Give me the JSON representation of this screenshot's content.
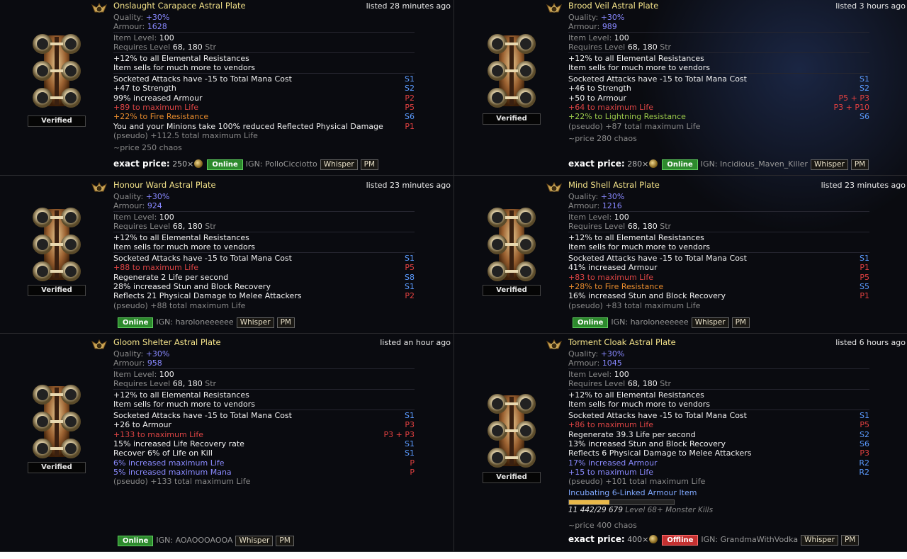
{
  "items": [
    {
      "title": "Onslaught Carapace Astral Plate",
      "listed": "listed 28 minutes ago",
      "verified": "Verified",
      "quality_label": "Quality: ",
      "quality": "+30%",
      "armour_label": "Armour: ",
      "armour": "1628",
      "ilvl_label": "Item Level: ",
      "ilvl": "100",
      "req_label": "Requires Level ",
      "req_lvl": "68",
      "req_sep": ", ",
      "req_str": "180",
      "req_stat": " Str",
      "implicits": [
        "+12% to all Elemental Resistances",
        "Item sells for much more to vendors"
      ],
      "mods": [
        {
          "text": "Socketed Attacks have -15 to Total Mana Cost",
          "tag": "S1",
          "c": "white",
          "tc": "sblue"
        },
        {
          "text": "+47 to Strength",
          "tag": "S2",
          "c": "white",
          "tc": "sblue"
        },
        {
          "text": "99% increased Armour",
          "tag": "P2",
          "c": "white",
          "tc": "sred"
        },
        {
          "text": "+89 to maximum Life",
          "tag": "P5",
          "c": "red",
          "tc": "sred"
        },
        {
          "text": "+22% to Fire Resistance",
          "tag": "S6",
          "c": "orange",
          "tc": "sblue"
        },
        {
          "text": "You and your Minions take 100% reduced Reflected Physical Damage",
          "tag": "P1",
          "c": "white",
          "tc": "sred"
        },
        {
          "text": "(pseudo) +112.5 total maximum Life",
          "tag": "",
          "c": "grey",
          "tc": "grey"
        }
      ],
      "note": "~price 250 chaos",
      "exact_label": "exact price:",
      "exact_value": "250×",
      "status": "Online",
      "ign": "IGN: PolloCicciotto",
      "whisper": "Whisper",
      "pm": "PM"
    },
    {
      "title": "Brood Veil Astral Plate",
      "listed": "listed 3 hours ago",
      "verified": "Verified",
      "quality_label": "Quality: ",
      "quality": "+30%",
      "armour_label": "Armour: ",
      "armour": "989",
      "ilvl_label": "Item Level: ",
      "ilvl": "100",
      "req_label": "Requires Level ",
      "req_lvl": "68",
      "req_sep": ", ",
      "req_str": "180",
      "req_stat": " Str",
      "implicits": [
        "+12% to all Elemental Resistances",
        "Item sells for much more to vendors"
      ],
      "mods": [
        {
          "text": "Socketed Attacks have -15 to Total Mana Cost",
          "tag": "S1",
          "c": "white",
          "tc": "sblue"
        },
        {
          "text": "+46 to Strength",
          "tag": "S2",
          "c": "white",
          "tc": "sblue"
        },
        {
          "text": "+50 to Armour",
          "tag": "P5 + P3",
          "c": "white",
          "tc": "sred"
        },
        {
          "text": "+64 to maximum Life",
          "tag": "P3 + P10",
          "c": "red",
          "tc": "sred"
        },
        {
          "text": "+22% to Lightning Resistance",
          "tag": "S6",
          "c": "green",
          "tc": "sblue"
        },
        {
          "text": "(pseudo) +87 total maximum Life",
          "tag": "",
          "c": "grey",
          "tc": "grey"
        }
      ],
      "note": "~price 280 chaos",
      "exact_label": "exact price:",
      "exact_value": "280×",
      "status": "Online",
      "ign": "IGN: Incidious_Maven_Killer",
      "whisper": "Whisper",
      "pm": "PM"
    },
    {
      "title": "Honour Ward Astral Plate",
      "listed": "listed 23 minutes ago",
      "verified": "Verified",
      "quality_label": "Quality: ",
      "quality": "+30%",
      "armour_label": "Armour: ",
      "armour": "924",
      "ilvl_label": "Item Level: ",
      "ilvl": "100",
      "req_label": "Requires Level ",
      "req_lvl": "68",
      "req_sep": ", ",
      "req_str": "180",
      "req_stat": " Str",
      "implicits": [
        "+12% to all Elemental Resistances",
        "Item sells for much more to vendors"
      ],
      "mods": [
        {
          "text": "Socketed Attacks have -15 to Total Mana Cost",
          "tag": "S1",
          "c": "white",
          "tc": "sblue"
        },
        {
          "text": "+88 to maximum Life",
          "tag": "P5",
          "c": "red",
          "tc": "sred"
        },
        {
          "text": "Regenerate 2 Life per second",
          "tag": "S8",
          "c": "white",
          "tc": "sblue"
        },
        {
          "text": "28% increased Stun and Block Recovery",
          "tag": "S1",
          "c": "white",
          "tc": "sblue"
        },
        {
          "text": "Reflects 21 Physical Damage to Melee Attackers",
          "tag": "P2",
          "c": "white",
          "tc": "sred"
        },
        {
          "text": "(pseudo) +88 total maximum Life",
          "tag": "",
          "c": "grey",
          "tc": "grey"
        }
      ],
      "note": "",
      "exact_label": "",
      "exact_value": "",
      "status": "Online",
      "ign": "IGN: haroloneeeeee",
      "whisper": "Whisper",
      "pm": "PM"
    },
    {
      "title": "Mind Shell Astral Plate",
      "listed": "listed 23 minutes ago",
      "verified": "Verified",
      "quality_label": "Quality: ",
      "quality": "+30%",
      "armour_label": "Armour: ",
      "armour": "1216",
      "ilvl_label": "Item Level: ",
      "ilvl": "100",
      "req_label": "Requires Level ",
      "req_lvl": "68",
      "req_sep": ", ",
      "req_str": "180",
      "req_stat": " Str",
      "implicits": [
        "+12% to all Elemental Resistances",
        "Item sells for much more to vendors"
      ],
      "mods": [
        {
          "text": "Socketed Attacks have -15 to Total Mana Cost",
          "tag": "S1",
          "c": "white",
          "tc": "sblue"
        },
        {
          "text": "41% increased Armour",
          "tag": "P1",
          "c": "white",
          "tc": "sred"
        },
        {
          "text": "+83 to maximum Life",
          "tag": "P5",
          "c": "red",
          "tc": "sred"
        },
        {
          "text": "+28% to Fire Resistance",
          "tag": "S5",
          "c": "orange",
          "tc": "sblue"
        },
        {
          "text": "16% increased Stun and Block Recovery",
          "tag": "P1",
          "c": "white",
          "tc": "sred"
        },
        {
          "text": "(pseudo) +83 total maximum Life",
          "tag": "",
          "c": "grey",
          "tc": "grey"
        }
      ],
      "note": "",
      "exact_label": "",
      "exact_value": "",
      "status": "Online",
      "ign": "IGN: haroloneeeeee",
      "whisper": "Whisper",
      "pm": "PM"
    },
    {
      "title": "Gloom Shelter Astral Plate",
      "listed": "listed an hour ago",
      "verified": "Verified",
      "quality_label": "Quality: ",
      "quality": "+30%",
      "armour_label": "Armour: ",
      "armour": "958",
      "ilvl_label": "Item Level: ",
      "ilvl": "100",
      "req_label": "Requires Level ",
      "req_lvl": "68",
      "req_sep": ", ",
      "req_str": "180",
      "req_stat": " Str",
      "implicits": [
        "+12% to all Elemental Resistances",
        "Item sells for much more to vendors"
      ],
      "mods": [
        {
          "text": "Socketed Attacks have -15 to Total Mana Cost",
          "tag": "S1",
          "c": "white",
          "tc": "sblue"
        },
        {
          "text": "+26 to Armour",
          "tag": "P3",
          "c": "white",
          "tc": "sred"
        },
        {
          "text": "+133 to maximum Life",
          "tag": "P3 + P3",
          "c": "red",
          "tc": "sred"
        },
        {
          "text": "15% increased Life Recovery rate",
          "tag": "S1",
          "c": "white",
          "tc": "sblue"
        },
        {
          "text": "Recover 6% of Life on Kill",
          "tag": "S1",
          "c": "white",
          "tc": "sblue"
        },
        {
          "text": "6% increased maximum Life",
          "tag": "P",
          "c": "mblue",
          "tc": "sred"
        },
        {
          "text": "5% increased maximum Mana",
          "tag": "P",
          "c": "mblue",
          "tc": "sred"
        },
        {
          "text": "(pseudo) +133 total maximum Life",
          "tag": "",
          "c": "grey",
          "tc": "grey"
        }
      ],
      "note": "",
      "exact_label": "",
      "exact_value": "",
      "status": "Online",
      "ign": "IGN: AOAOOOAOOA",
      "whisper": "Whisper",
      "pm": "PM"
    },
    {
      "title": "Torment Cloak Astral Plate",
      "listed": "listed 6 hours ago",
      "verified": "Verified",
      "quality_label": "Quality: ",
      "quality": "+30%",
      "armour_label": "Armour: ",
      "armour": "1045",
      "ilvl_label": "Item Level: ",
      "ilvl": "100",
      "req_label": "Requires Level ",
      "req_lvl": "68",
      "req_sep": ", ",
      "req_str": "180",
      "req_stat": " Str",
      "implicits": [
        "+12% to all Elemental Resistances",
        "Item sells for much more to vendors"
      ],
      "mods": [
        {
          "text": "Socketed Attacks have -15 to Total Mana Cost",
          "tag": "S1",
          "c": "white",
          "tc": "sblue"
        },
        {
          "text": "+86 to maximum Life",
          "tag": "P5",
          "c": "red",
          "tc": "sred"
        },
        {
          "text": "Regenerate 39.3 Life per second",
          "tag": "S2",
          "c": "white",
          "tc": "sblue"
        },
        {
          "text": "13% increased Stun and Block Recovery",
          "tag": "S6",
          "c": "white",
          "tc": "sblue"
        },
        {
          "text": "Reflects 6 Physical Damage to Melee Attackers",
          "tag": "P3",
          "c": "white",
          "tc": "sred"
        },
        {
          "text": "17% increased Armour",
          "tag": "R2",
          "c": "mblue",
          "tc": "sblue"
        },
        {
          "text": "+15 to maximum Life",
          "tag": "R2",
          "c": "mblue",
          "tc": "sblue"
        },
        {
          "text": "(pseudo) +101 total maximum Life",
          "tag": "",
          "c": "grey",
          "tc": "grey"
        }
      ],
      "incubator": {
        "label": "Incubating 6-Linked Armour Item",
        "progress_fraction": 0.385,
        "count": "11 442/29 679",
        "requirement": " Level 68+ Monster Kills"
      },
      "note": "~price 400 chaos",
      "exact_label": "exact price:",
      "exact_value": "400×",
      "status": "Offline",
      "ign": "IGN: GrandmaWithVodka",
      "whisper": "Whisper",
      "pm": "PM"
    }
  ]
}
